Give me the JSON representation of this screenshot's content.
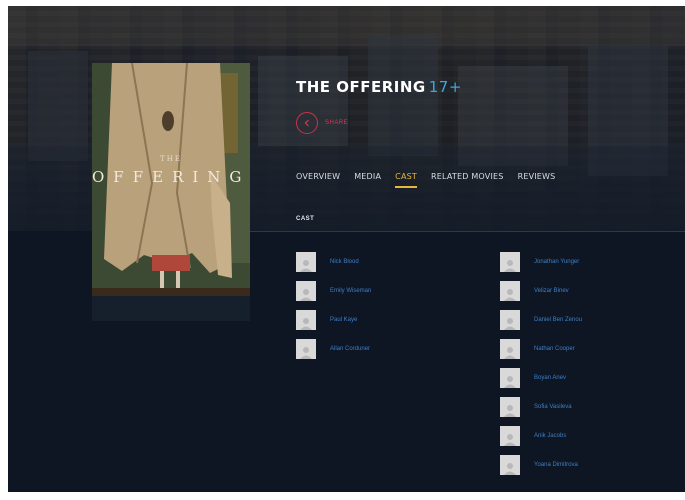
{
  "movie": {
    "title": "THE OFFERING",
    "rating": "17+",
    "poster_title": "OFFERING",
    "poster_the": "THE"
  },
  "share": {
    "label": "SHARE",
    "icon": "share-icon"
  },
  "tabs": [
    {
      "label": "OVERVIEW",
      "active": false
    },
    {
      "label": "MEDIA",
      "active": false
    },
    {
      "label": "CAST",
      "active": true
    },
    {
      "label": "RELATED MOVIES",
      "active": false
    },
    {
      "label": "REVIEWS",
      "active": false
    }
  ],
  "section": {
    "label": "CAST"
  },
  "cast_left": [
    {
      "name": "Nick Blood"
    },
    {
      "name": "Emily Wiseman"
    },
    {
      "name": "Paul Kaye"
    },
    {
      "name": "Allan Corduner"
    }
  ],
  "cast_right": [
    {
      "name": "Jonathan Yunger"
    },
    {
      "name": "Velizar Binev"
    },
    {
      "name": "Daniel Ben Zenou"
    },
    {
      "name": "Nathan Cooper"
    },
    {
      "name": "Boyan Anev"
    },
    {
      "name": "Sofia Vasileva"
    },
    {
      "name": "Anik Jacobs"
    },
    {
      "name": "Yoana Dimitrova"
    }
  ],
  "colors": {
    "background": "#0d1622",
    "accent_tab": "#e8b63a",
    "rating": "#3aa8e0",
    "share": "#d8364f",
    "cast_link": "#3f7fc8"
  }
}
